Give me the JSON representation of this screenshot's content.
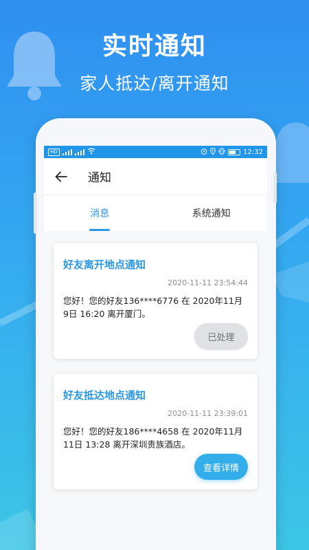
{
  "promo": {
    "title": "实时通知",
    "subtitle": "家人抵达/离开通知"
  },
  "statusbar": {
    "time": "12:32",
    "chip1": "HD",
    "chip2": "4G"
  },
  "navbar": {
    "title": "通知"
  },
  "tabs": [
    {
      "label": "消息",
      "active": true
    },
    {
      "label": "系统通知",
      "active": false
    }
  ],
  "notifications": [
    {
      "title": "好友离开地点通知",
      "time": "2020-11-11 23:54:44",
      "body": "您好！您的好友136****6776 在 2020年11月9日 16:20 离开厦门。",
      "action": "已处理"
    },
    {
      "title": "好友抵达地点通知",
      "time": "2020-11-11 23:39:01",
      "body": "您好！您的好友186****4658 在 2020年11月11日 13:28 离开深圳贵族酒店。",
      "action": "查看详情"
    }
  ],
  "colors": {
    "accent": "#2a97e4",
    "statusbar": "#2196e8",
    "background_top": "#2f8ff0",
    "background_bottom": "#3cc6e6"
  }
}
